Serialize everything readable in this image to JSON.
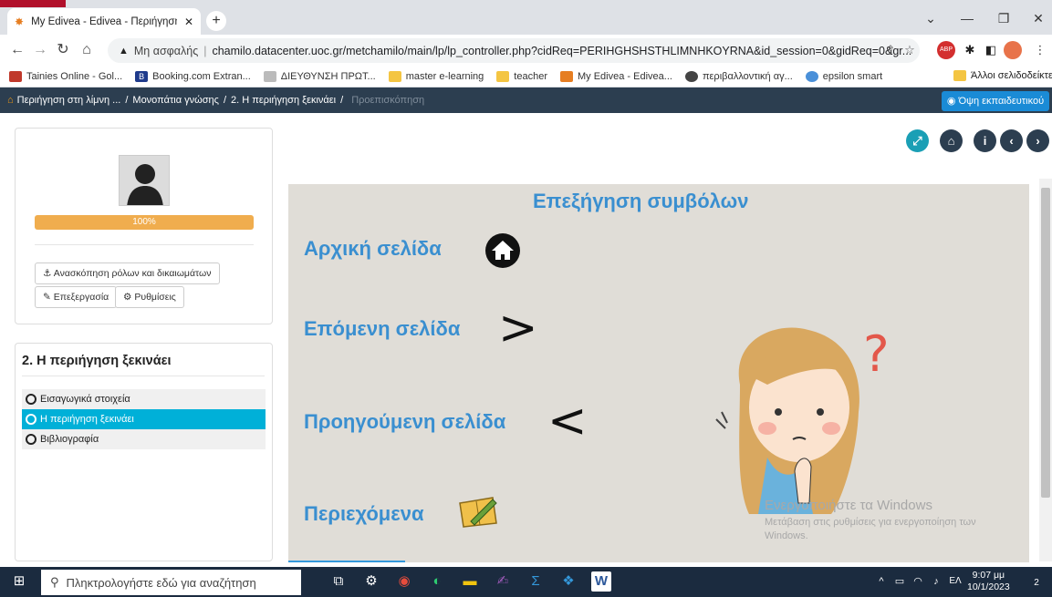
{
  "browser": {
    "tab_title": "My Edivea - Edivea - Περιήγηση",
    "security_label": "Μη ασφαλής",
    "url": "chamilo.datacenter.uoc.gr/metchamilo/main/lp/lp_controller.php?cidReq=PERIHGHSHSTHLIMNHKOYRNA&id_session=0&gidReq=0&gr...",
    "new_tab": "+",
    "bookmarks": [
      {
        "label": "Tainies Online - Gol...",
        "color": "#c0392b"
      },
      {
        "label": "Booking.com Extran...",
        "color": "#1f3b8c"
      },
      {
        "label": "ΔΙΕΥΘΥΝΣΗ ΠΡΩΤ...",
        "color": "#999999"
      },
      {
        "label": "master e-learning",
        "color": "#f4c542"
      },
      {
        "label": "teacher",
        "color": "#f4c542"
      },
      {
        "label": "My Edivea - Edivea...",
        "color": "#e67e22"
      },
      {
        "label": "περιβαλλοντική αγ...",
        "color": "#444444"
      },
      {
        "label": "epsilon smart",
        "color": "#4a90d9"
      }
    ],
    "other_bookmarks": "Άλλοι σελιδοδείκτες"
  },
  "appbar": {
    "crumb1": "Περιήγηση στη λίμνη ...",
    "crumb2": "Μονοπάτια γνώσης",
    "crumb3": "2. Η περιήγηση ξεκινάει",
    "crumb4": "Προεπισκόπηση",
    "separator": "/",
    "teacher_view": "Όψη εκπαιδευτικού"
  },
  "profile": {
    "progress_label": "100%",
    "progress_value": 1.0,
    "roles_button": "Ανασκόπηση ρόλων και δικαιωμάτων",
    "edit_button": "Επεξεργασία",
    "settings_button": "Ρυθμίσεις"
  },
  "outline": {
    "title": "2. Η περιήγηση ξεκινάει",
    "items": [
      {
        "label": "Εισαγωγικά στοιχεία"
      },
      {
        "label": "Η περιήγηση ξεκινάει"
      },
      {
        "label": "Βιβλιογραφία"
      }
    ]
  },
  "content": {
    "heading": "Επεξήγηση συμβόλων",
    "home": "Αρχική σελίδα",
    "next": "Επόμενη σελίδα",
    "prev": "Προηγούμενη σελίδα",
    "toc": "Περιεχόμενα",
    "next_arrow": ">",
    "prev_arrow": "<",
    "question_mark": "?"
  },
  "watermark": {
    "line1": "Ενεργοποιήστε τα Windows",
    "line2": "Μετάβαση στις ρυθμίσεις για ενεργοποίηση των",
    "line3": "Windows."
  },
  "taskbar": {
    "search_placeholder": "Πληκτρολογήστε εδώ για αναζήτηση",
    "lang": "ΕΛ",
    "time": "9:07 μμ",
    "date": "10/1/2023",
    "notifications": "2"
  }
}
